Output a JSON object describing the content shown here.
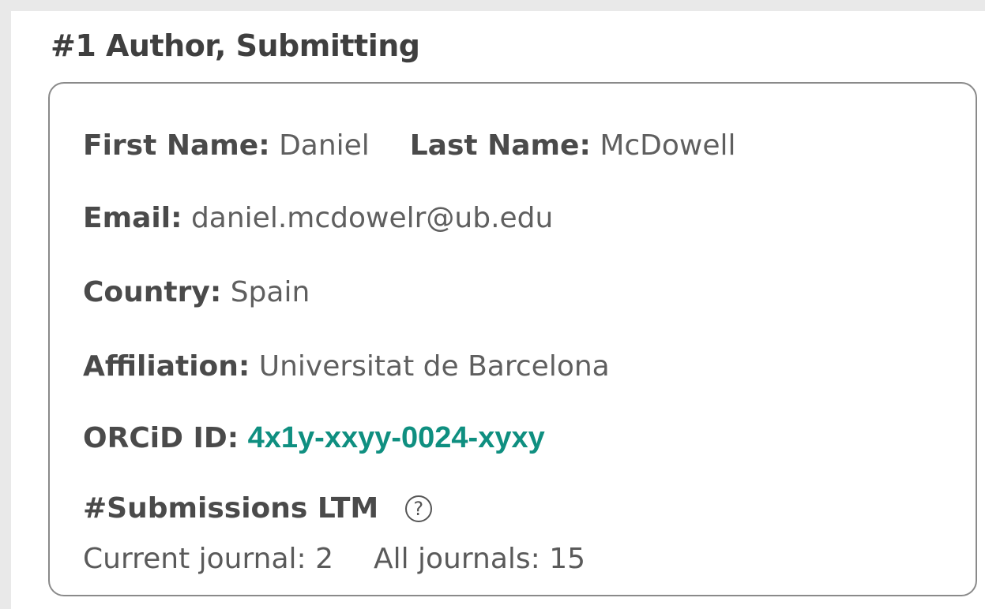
{
  "section": {
    "title": "#1 Author, Submitting"
  },
  "author": {
    "first_name_label": "First Name:",
    "first_name": "Daniel",
    "last_name_label": "Last Name:",
    "last_name": "McDowell",
    "email_label": "Email:",
    "email": "daniel.mcdowelr@ub.edu",
    "country_label": "Country:",
    "country": "Spain",
    "affiliation_label": "Affiliation:",
    "affiliation": "Universitat de Barcelona",
    "orcid_label": "ORCiD ID:",
    "orcid": "4x1y-xxyy-0024-xyxy"
  },
  "submissions": {
    "title": "#Submissions LTM",
    "help_icon": "question-circle-icon",
    "help_glyph": "?",
    "current_label": "Current journal:",
    "current_value": "2",
    "all_label": "All journals:",
    "all_value": "15"
  },
  "colors": {
    "orcid_link": "#0f8f80",
    "border": "#8a8a8a",
    "label_text": "#4a4a4a",
    "value_text": "#5f5f5f"
  }
}
